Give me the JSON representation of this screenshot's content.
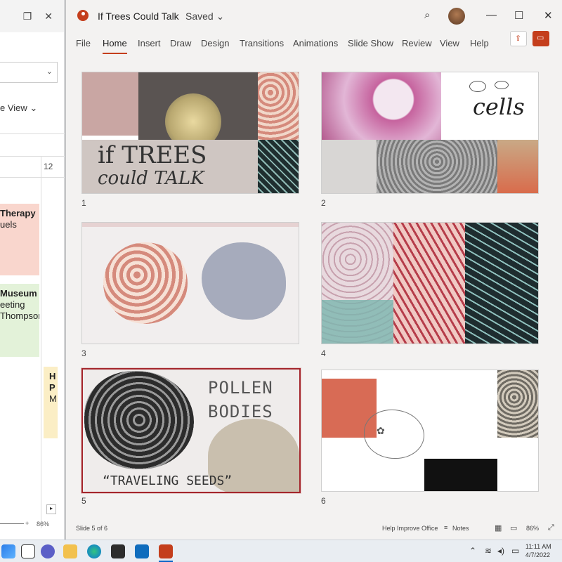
{
  "calendar": {
    "view_label": "e View",
    "col_header": "12",
    "event1": {
      "title": "Therapy",
      "sub": "uels"
    },
    "event2": {
      "title": "Museum",
      "line2": "eeting",
      "line3": "Thompson"
    },
    "event3": {
      "l1": "H",
      "l2": "P",
      "l3": "M"
    },
    "zoom": "86%"
  },
  "ppt": {
    "title": "If Trees Could Talk",
    "saved": "Saved",
    "menu": [
      "File",
      "Home",
      "Insert",
      "Draw",
      "Design",
      "Transitions",
      "Animations",
      "Slide Show",
      "Review",
      "View",
      "Help"
    ],
    "active_menu": "Home",
    "slides": [
      {
        "num": "1",
        "t1": "if TREES",
        "t2": "could TALK"
      },
      {
        "num": "2",
        "t1": "cells"
      },
      {
        "num": "3"
      },
      {
        "num": "4"
      },
      {
        "num": "5",
        "t1": "POLLEN",
        "t2": "BODIES",
        "t3": "“TRAVELING SEEDS”"
      },
      {
        "num": "6"
      }
    ],
    "status": {
      "slide_of": "Slide 5 of 6",
      "help": "Help Improve Office",
      "notes": "Notes",
      "zoom": "86%"
    }
  },
  "taskbar": {
    "time": "11:11 AM",
    "date": "4/7/2022"
  },
  "colors": {
    "accent": "#c43e1c",
    "selected_border": "#a4262c"
  }
}
